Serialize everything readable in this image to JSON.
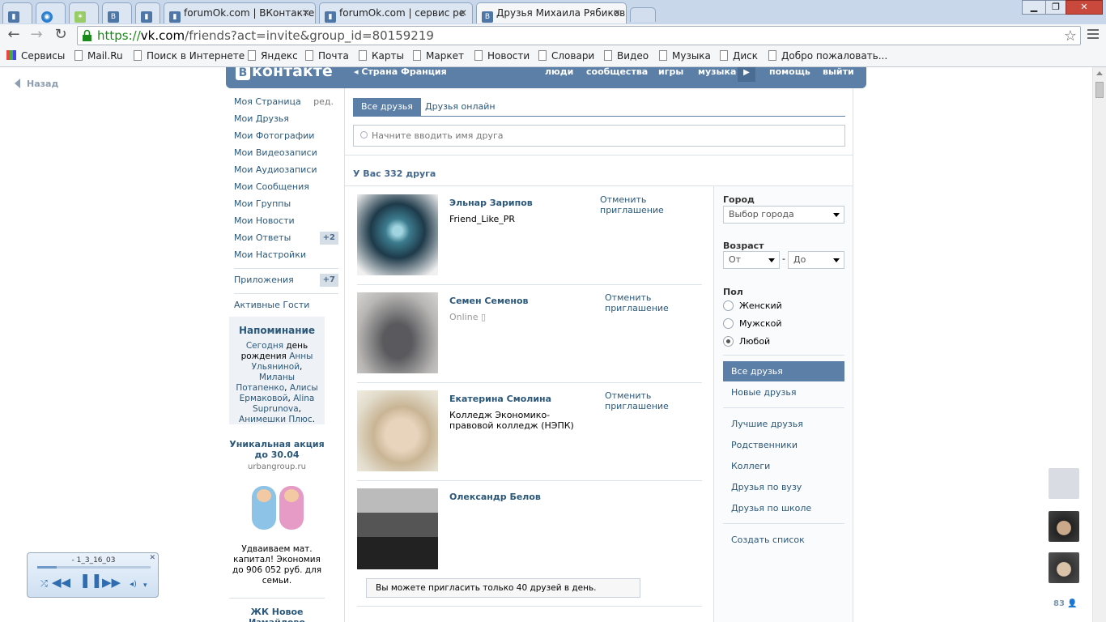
{
  "browser": {
    "tabs": [
      {
        "label": "",
        "icon": "bookmark-icon"
      },
      {
        "label": "",
        "icon": "globe-icon"
      },
      {
        "label": "",
        "icon": "dots-icon"
      },
      {
        "label": "",
        "icon": "vk-icon"
      },
      {
        "label": "",
        "icon": "bookmark-icon"
      },
      {
        "label": "forumOk.com | ВКонтакте",
        "icon": "bookmark-icon"
      },
      {
        "label": "forumOk.com | сервис ре",
        "icon": "bookmark-icon"
      },
      {
        "label": "Друзья Михаила Рябиков",
        "icon": "vk-icon"
      }
    ],
    "url_scheme": "https://",
    "url_host": "vk.com",
    "url_path": "/friends?act=invite&group_id=80159219",
    "bookmarks": [
      "Сервисы",
      "Mail.Ru",
      "Поиск в Интернете",
      "Яндекс",
      "Почта",
      "Карты",
      "Маркет",
      "Новости",
      "Словари",
      "Видео",
      "Музыка",
      "Диск",
      "Добро пожаловать..."
    ]
  },
  "page": {
    "back_label": "Назад",
    "header": {
      "logo_letter": "В",
      "logo_text": "контакте",
      "country": "Страна Франция",
      "links": [
        "люди",
        "сообщества",
        "игры",
        "музыка",
        "помощь",
        "выйти"
      ]
    },
    "left_menu": {
      "edit_label": "ред.",
      "items": [
        {
          "label": "Моя Страница",
          "badge": ""
        },
        {
          "label": "Мои Друзья",
          "badge": ""
        },
        {
          "label": "Мои Фотографии",
          "badge": ""
        },
        {
          "label": "Мои Видеозаписи",
          "badge": ""
        },
        {
          "label": "Мои Аудиозаписи",
          "badge": ""
        },
        {
          "label": "Мои Сообщения",
          "badge": ""
        },
        {
          "label": "Мои Группы",
          "badge": ""
        },
        {
          "label": "Мои Новости",
          "badge": ""
        },
        {
          "label": "Мои Ответы",
          "badge": "+2"
        },
        {
          "label": "Мои Настройки",
          "badge": ""
        }
      ],
      "apps": {
        "label": "Приложения",
        "badge": "+7"
      },
      "guests": "Активные Гости"
    },
    "reminder": {
      "title": "Напоминание",
      "text_today": "Сегодня",
      "text_bday": " день рождения ",
      "names_1": "Анны Ульяниной",
      "names_2": "Миланы Потапенко",
      "names_3": "Алисы Ермаковой",
      "names_4": "Alina Suprunova",
      "names_5": "Анимешки Плюс"
    },
    "ad": {
      "title": "Уникальная акция до 30.04",
      "domain": "urbangroup.ru",
      "text": "Удваиваем мат. капитал! Экономия до 906 052 руб. для семьи.",
      "title2": "ЖК Новое Измайлово"
    },
    "friends": {
      "tab_all": "Все друзья",
      "tab_online": "Друзья онлайн",
      "search_placeholder": "Начните вводить имя друга",
      "count_label": "У Вас 332 друга",
      "list": [
        {
          "name": "Эльнар Зарипов",
          "sub": "Friend_Like_PR",
          "cancel": "Отменить приглашение"
        },
        {
          "name": "Семен Семенов",
          "sub": "Online",
          "cancel": "Отменить приглашение"
        },
        {
          "name": "Екатерина Смолина",
          "sub": "Колледж Экономико-правовой колледж (НЭПК)",
          "cancel": "Отменить приглашение"
        },
        {
          "name": "Олександр Белов",
          "sub": "",
          "cancel": ""
        }
      ],
      "notice": "Вы можете пригласить только 40 друзей в день."
    },
    "filters": {
      "city_label": "Город",
      "city_select": "Выбор города",
      "age_label": "Возраст",
      "age_from": "От",
      "age_dash": "-",
      "age_to": "До",
      "sex_label": "Пол",
      "sex_options": [
        "Женский",
        "Мужской",
        "Любой"
      ],
      "sex_selected": "Любой",
      "nav": [
        "Все друзья",
        "Новые друзья"
      ],
      "lists": [
        "Лучшие друзья",
        "Родственники",
        "Коллеги",
        "Друзья по вузу",
        "Друзья по школе"
      ],
      "create_list": "Создать список"
    },
    "player": {
      "track": "- 1_3_16_03",
      "progress": 0.17
    },
    "side_count": "83"
  }
}
